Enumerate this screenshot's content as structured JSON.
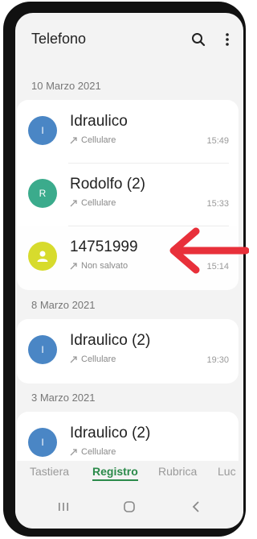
{
  "header": {
    "title": "Telefono",
    "search_icon": "search-icon",
    "more_icon": "more-vert-icon"
  },
  "groups": [
    {
      "date": "10 Marzo 2021",
      "entries": [
        {
          "name": "Idraulico",
          "sub": "Cellulare",
          "time": "15:49",
          "avatar": "I",
          "color": "#4a86c5"
        },
        {
          "name": "Rodolfo (2)",
          "sub": "Cellulare",
          "time": "15:33",
          "avatar": "R",
          "color": "#3bab8c"
        },
        {
          "name": "14751999",
          "sub": "Non salvato",
          "time": "15:14",
          "avatar": "person",
          "color": "#d7db2d"
        }
      ]
    },
    {
      "date": "8 Marzo 2021",
      "entries": [
        {
          "name": "Idraulico (2)",
          "sub": "Cellulare",
          "time": "19:30",
          "avatar": "I",
          "color": "#4a86c5"
        }
      ]
    },
    {
      "date": "3 Marzo 2021",
      "entries": [
        {
          "name": "Idraulico (2)",
          "sub": "Cellulare",
          "time": "",
          "avatar": "I",
          "color": "#4a86c5"
        }
      ]
    }
  ],
  "tabs": [
    "Tastiera",
    "Registro",
    "Rubrica",
    "Luc"
  ],
  "active_tab": "Registro",
  "accent": "#2b8a4a",
  "annotation_color": "#e8303a"
}
